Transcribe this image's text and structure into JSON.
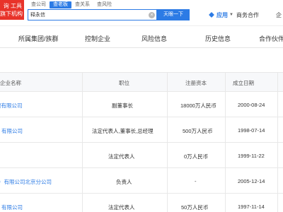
{
  "logo": {
    "line1": "询 工具",
    "line2": "旗下机构"
  },
  "search": {
    "tabs": [
      "查公司",
      "查老板",
      "查关系",
      "查风险"
    ],
    "active_tab_index": 1,
    "query": "释永信",
    "button_label": "天眼一下"
  },
  "nav": {
    "app_label": "应用",
    "business": "商务合作",
    "more": "企"
  },
  "categories": [
    "所属集团/族群",
    "控制企业",
    "风险信息",
    "历史信息",
    "合作伙伴"
  ],
  "table": {
    "headers": {
      "company": "企业名称",
      "position": "职位",
      "capital": "注册资本",
      "date": "成立日期"
    },
    "rows": [
      {
        "company": "限有限公司",
        "position": "副董事长",
        "capital": "18000万人民币",
        "date": "2000-08-24"
      },
      {
        "company": "有限公司",
        "position": "法定代表人,董事长,总经理",
        "capital": "500万人民币",
        "date": "1998-07-14"
      },
      {
        "company": "",
        "position": "法定代表人",
        "capital": "0万人民币",
        "date": "1999-11-22"
      },
      {
        "company": "）有限公司北京分公司",
        "position": "负责人",
        "capital": "-",
        "date": "2005-12-14"
      },
      {
        "company": "有限公司",
        "position": "法定代表人",
        "capital": "50万人民币",
        "date": "1997-11-14"
      }
    ]
  },
  "colors": {
    "accent": "#2c7be5",
    "brand_red": "#e8332a"
  }
}
